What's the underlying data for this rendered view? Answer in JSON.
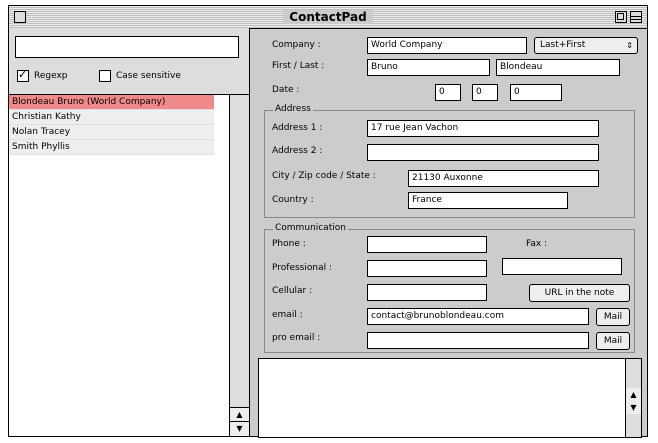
{
  "window": {
    "title": "ContactPad"
  },
  "left": {
    "search_value": "",
    "regexp_label": "Regexp",
    "regexp_checked": true,
    "case_label": "Case sensitive",
    "case_checked": false,
    "contacts": [
      {
        "name": "Blondeau Bruno (World Company)",
        "selected": true
      },
      {
        "name": "Christian Kathy",
        "selected": false
      },
      {
        "name": "Nolan Tracey",
        "selected": false
      },
      {
        "name": "Smith Phyllis",
        "selected": false
      }
    ]
  },
  "form": {
    "company_label": "Company :",
    "company_value": "World Company",
    "sort_value": "Last+First",
    "firstlast_label": "First / Last :",
    "first_value": "Bruno",
    "last_value": "Blondeau",
    "date_label": "Date :",
    "date_d": "0",
    "date_m": "0",
    "date_y": "0",
    "address_title": "Address",
    "addr1_label": "Address 1 :",
    "addr1_value": "17 rue Jean Vachon",
    "addr2_label": "Address 2 :",
    "addr2_value": "",
    "city_label": "City / Zip code / State :",
    "city_value": "21130 Auxonne",
    "country_label": "Country :",
    "country_value": "France",
    "comm_title": "Communication",
    "phone_label": "Phone :",
    "phone_value": "",
    "fax_label": "Fax :",
    "fax_value": "",
    "pro_label": "Professional :",
    "pro_value": "",
    "cell_label": "Cellular :",
    "cell_value": "",
    "url_button": "URL in the note",
    "email_label": "email :",
    "email_value": "contact@brunoblondeau.com",
    "proemail_label": "pro email :",
    "proemail_value": "",
    "mail_button": "Mail",
    "note_value": ""
  }
}
